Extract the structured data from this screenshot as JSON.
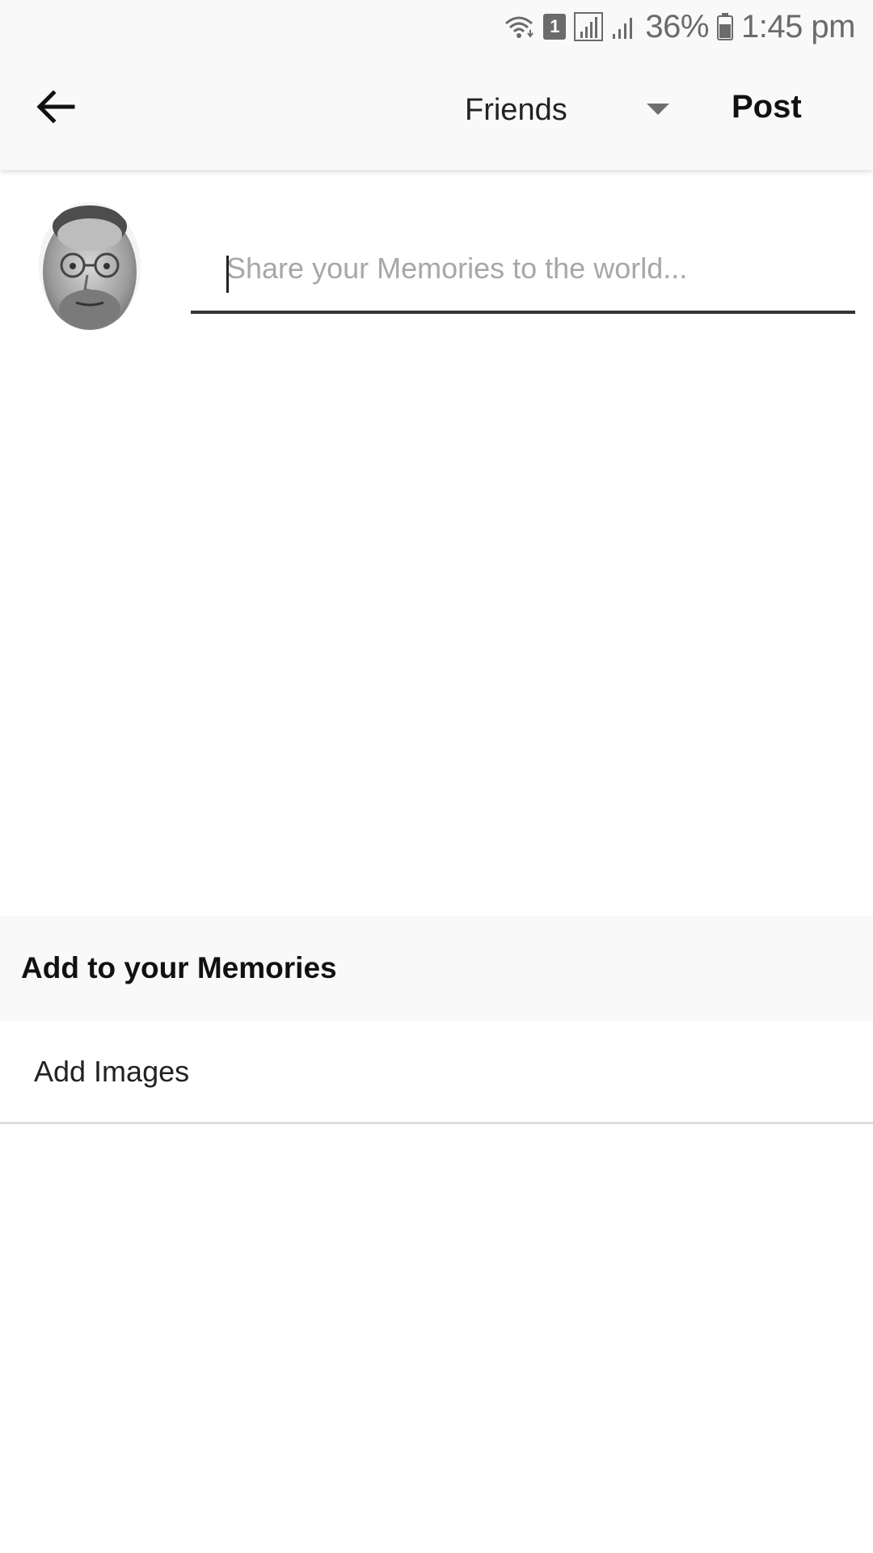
{
  "status_bar": {
    "battery_percent": "36%",
    "time": "1:45 pm",
    "sim_badge": "1",
    "icons": [
      "wifi-icon",
      "sim-icon",
      "signal-icon",
      "signal-icon",
      "battery-icon"
    ]
  },
  "app_bar": {
    "back_icon": "arrow-left-icon",
    "audience": "Friends",
    "post_label": "Post"
  },
  "composer": {
    "placeholder": "Share your Memories to the world...",
    "value": ""
  },
  "add_section": {
    "title": "Add to your Memories",
    "items": [
      {
        "label": "Add Images"
      }
    ]
  },
  "colors": {
    "bar_background": "#f9f9f9",
    "text_primary": "#111111",
    "placeholder": "#a7a7a7",
    "underline": "#333333",
    "divider": "#dedede"
  }
}
